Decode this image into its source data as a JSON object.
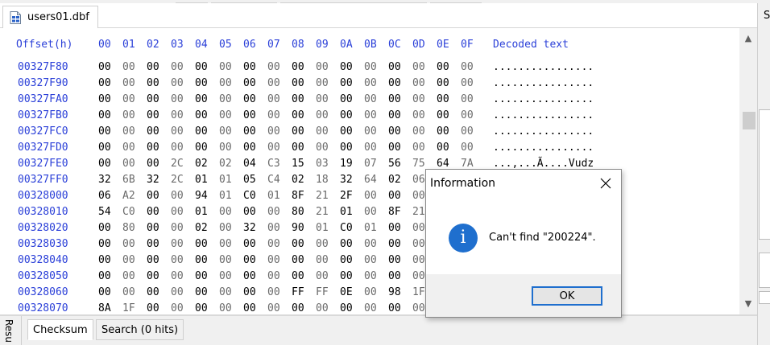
{
  "file_tab": {
    "label": "users01.dbf"
  },
  "side_panel": {
    "letter": "S"
  },
  "header": {
    "offset": "Offset(h)",
    "columns": [
      "00",
      "01",
      "02",
      "03",
      "04",
      "05",
      "06",
      "07",
      "08",
      "09",
      "0A",
      "0B",
      "0C",
      "0D",
      "0E",
      "0F"
    ],
    "decoded": "Decoded text"
  },
  "rows": [
    {
      "offset": "00327F80",
      "bytes": [
        "00",
        "00",
        "00",
        "00",
        "00",
        "00",
        "00",
        "00",
        "00",
        "00",
        "00",
        "00",
        "00",
        "00",
        "00",
        "00"
      ],
      "decoded": "................"
    },
    {
      "offset": "00327F90",
      "bytes": [
        "00",
        "00",
        "00",
        "00",
        "00",
        "00",
        "00",
        "00",
        "00",
        "00",
        "00",
        "00",
        "00",
        "00",
        "00",
        "00"
      ],
      "decoded": "................"
    },
    {
      "offset": "00327FA0",
      "bytes": [
        "00",
        "00",
        "00",
        "00",
        "00",
        "00",
        "00",
        "00",
        "00",
        "00",
        "00",
        "00",
        "00",
        "00",
        "00",
        "00"
      ],
      "decoded": "................"
    },
    {
      "offset": "00327FB0",
      "bytes": [
        "00",
        "00",
        "00",
        "00",
        "00",
        "00",
        "00",
        "00",
        "00",
        "00",
        "00",
        "00",
        "00",
        "00",
        "00",
        "00"
      ],
      "decoded": "................"
    },
    {
      "offset": "00327FC0",
      "bytes": [
        "00",
        "00",
        "00",
        "00",
        "00",
        "00",
        "00",
        "00",
        "00",
        "00",
        "00",
        "00",
        "00",
        "00",
        "00",
        "00"
      ],
      "decoded": "................"
    },
    {
      "offset": "00327FD0",
      "bytes": [
        "00",
        "00",
        "00",
        "00",
        "00",
        "00",
        "00",
        "00",
        "00",
        "00",
        "00",
        "00",
        "00",
        "00",
        "00",
        "00"
      ],
      "decoded": "................"
    },
    {
      "offset": "00327FE0",
      "bytes": [
        "00",
        "00",
        "00",
        "2C",
        "02",
        "02",
        "04",
        "C3",
        "15",
        "03",
        "19",
        "07",
        "56",
        "75",
        "64",
        "7A"
      ],
      "decoded": "...,...Ã....Vudz"
    },
    {
      "offset": "00327FF0",
      "bytes": [
        "32",
        "6B",
        "32",
        "2C",
        "01",
        "01",
        "05",
        "C4",
        "02",
        "18",
        "32",
        "64",
        "02",
        "06",
        "",
        ""
      ],
      "decoded": ""
    },
    {
      "offset": "00328000",
      "bytes": [
        "06",
        "A2",
        "00",
        "00",
        "94",
        "01",
        "C0",
        "01",
        "8F",
        "21",
        "2F",
        "00",
        "00",
        "00",
        "",
        ""
      ],
      "decoded": ""
    },
    {
      "offset": "00328010",
      "bytes": [
        "54",
        "C0",
        "00",
        "00",
        "01",
        "00",
        "00",
        "00",
        "80",
        "21",
        "01",
        "00",
        "8F",
        "21",
        "",
        ""
      ],
      "decoded": ""
    },
    {
      "offset": "00328020",
      "bytes": [
        "00",
        "80",
        "00",
        "00",
        "02",
        "00",
        "32",
        "00",
        "90",
        "01",
        "C0",
        "01",
        "00",
        "00",
        "",
        ""
      ],
      "decoded": ""
    },
    {
      "offset": "00328030",
      "bytes": [
        "00",
        "00",
        "00",
        "00",
        "00",
        "00",
        "00",
        "00",
        "00",
        "00",
        "00",
        "00",
        "00",
        "00",
        "",
        ""
      ],
      "decoded": ""
    },
    {
      "offset": "00328040",
      "bytes": [
        "00",
        "00",
        "00",
        "00",
        "00",
        "00",
        "00",
        "00",
        "00",
        "00",
        "00",
        "00",
        "00",
        "00",
        "",
        ""
      ],
      "decoded": ""
    },
    {
      "offset": "00328050",
      "bytes": [
        "00",
        "00",
        "00",
        "00",
        "00",
        "00",
        "00",
        "00",
        "00",
        "00",
        "00",
        "00",
        "00",
        "00",
        "",
        ""
      ],
      "decoded": ""
    },
    {
      "offset": "00328060",
      "bytes": [
        "00",
        "00",
        "00",
        "00",
        "00",
        "00",
        "00",
        "00",
        "FF",
        "FF",
        "0E",
        "00",
        "98",
        "1F",
        "",
        ""
      ],
      "decoded": ""
    },
    {
      "offset": "00328070",
      "bytes": [
        "8A",
        "1F",
        "00",
        "00",
        "00",
        "00",
        "00",
        "00",
        "00",
        "00",
        "00",
        "00",
        "00",
        "00",
        "",
        ""
      ],
      "decoded": ""
    }
  ],
  "bottom_tabs": {
    "vertical_label": "Resu",
    "checksum": "Checksum",
    "search": "Search (0 hits)"
  },
  "dialog": {
    "title": "Information",
    "message": "Can't find \"200224\".",
    "ok_label": "OK",
    "icon_glyph": "i"
  },
  "colors": {
    "accent_blue": "#2a3fd8",
    "info_blue": "#1f6fce",
    "byte_dark": "#000000",
    "byte_gray": "#6a6a6a"
  }
}
